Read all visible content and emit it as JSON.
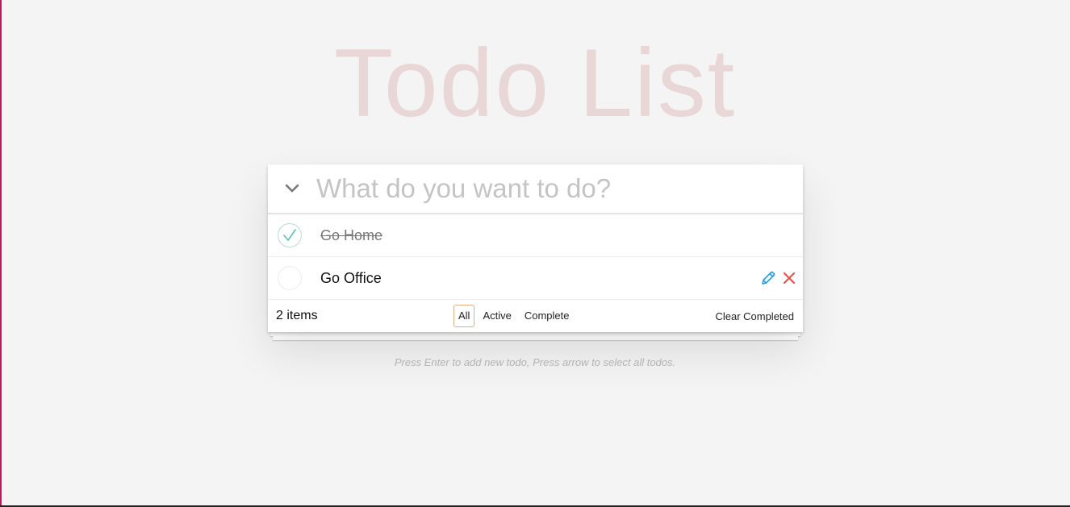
{
  "title": "Todo List",
  "new_todo": {
    "placeholder": "What do you want to do?",
    "value": ""
  },
  "icons": {
    "toggle_all": "chevron-down-icon",
    "check": "checkmark-icon",
    "edit": "pencil-icon",
    "delete": "close-icon"
  },
  "todos": [
    {
      "label": "Go Home",
      "completed": true
    },
    {
      "label": "Go Office",
      "completed": false
    }
  ],
  "footer": {
    "count": "2 items",
    "filters": [
      "All",
      "Active",
      "Complete"
    ],
    "selected_filter": "All",
    "clear_completed": "Clear Completed"
  },
  "info": "Press Enter to add new todo, Press arrow to select all todos.",
  "colors": {
    "title": "#f0d8d8",
    "check_mark": "#5dc2af",
    "edit": "#2b9fe0",
    "delete": "#e5534b",
    "filter_border": "#d9b08c",
    "accent_edge": "#c2185b"
  }
}
